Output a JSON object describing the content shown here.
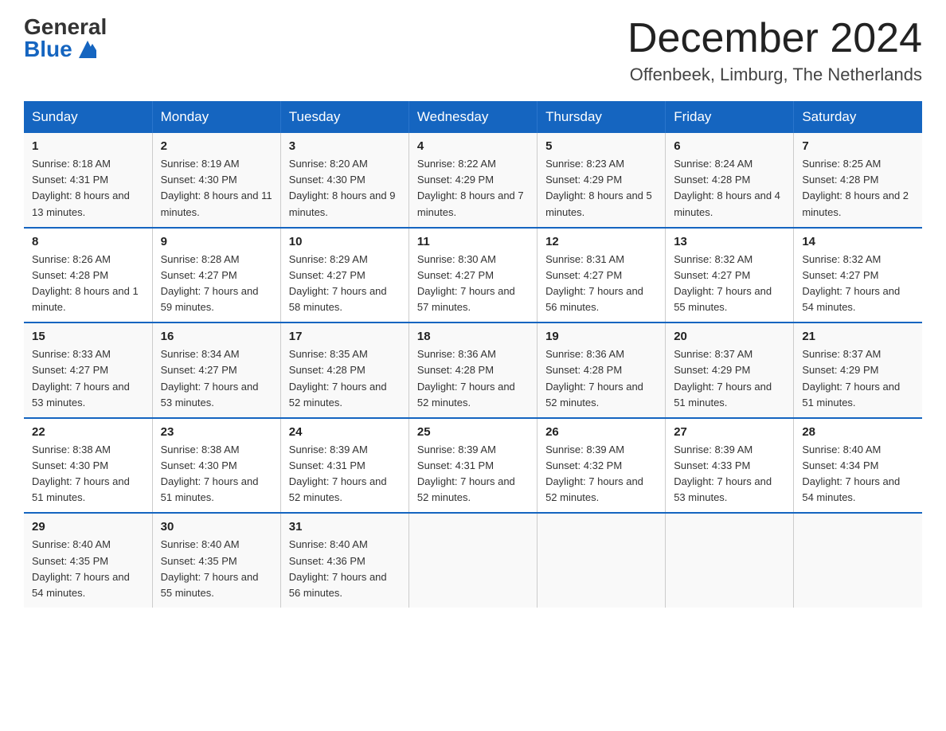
{
  "header": {
    "logo_general": "General",
    "logo_blue": "Blue",
    "month_title": "December 2024",
    "location": "Offenbeek, Limburg, The Netherlands"
  },
  "days_of_week": [
    "Sunday",
    "Monday",
    "Tuesday",
    "Wednesday",
    "Thursday",
    "Friday",
    "Saturday"
  ],
  "weeks": [
    [
      {
        "day": "1",
        "sunrise": "8:18 AM",
        "sunset": "4:31 PM",
        "daylight": "8 hours and 13 minutes."
      },
      {
        "day": "2",
        "sunrise": "8:19 AM",
        "sunset": "4:30 PM",
        "daylight": "8 hours and 11 minutes."
      },
      {
        "day": "3",
        "sunrise": "8:20 AM",
        "sunset": "4:30 PM",
        "daylight": "8 hours and 9 minutes."
      },
      {
        "day": "4",
        "sunrise": "8:22 AM",
        "sunset": "4:29 PM",
        "daylight": "8 hours and 7 minutes."
      },
      {
        "day": "5",
        "sunrise": "8:23 AM",
        "sunset": "4:29 PM",
        "daylight": "8 hours and 5 minutes."
      },
      {
        "day": "6",
        "sunrise": "8:24 AM",
        "sunset": "4:28 PM",
        "daylight": "8 hours and 4 minutes."
      },
      {
        "day": "7",
        "sunrise": "8:25 AM",
        "sunset": "4:28 PM",
        "daylight": "8 hours and 2 minutes."
      }
    ],
    [
      {
        "day": "8",
        "sunrise": "8:26 AM",
        "sunset": "4:28 PM",
        "daylight": "8 hours and 1 minute."
      },
      {
        "day": "9",
        "sunrise": "8:28 AM",
        "sunset": "4:27 PM",
        "daylight": "7 hours and 59 minutes."
      },
      {
        "day": "10",
        "sunrise": "8:29 AM",
        "sunset": "4:27 PM",
        "daylight": "7 hours and 58 minutes."
      },
      {
        "day": "11",
        "sunrise": "8:30 AM",
        "sunset": "4:27 PM",
        "daylight": "7 hours and 57 minutes."
      },
      {
        "day": "12",
        "sunrise": "8:31 AM",
        "sunset": "4:27 PM",
        "daylight": "7 hours and 56 minutes."
      },
      {
        "day": "13",
        "sunrise": "8:32 AM",
        "sunset": "4:27 PM",
        "daylight": "7 hours and 55 minutes."
      },
      {
        "day": "14",
        "sunrise": "8:32 AM",
        "sunset": "4:27 PM",
        "daylight": "7 hours and 54 minutes."
      }
    ],
    [
      {
        "day": "15",
        "sunrise": "8:33 AM",
        "sunset": "4:27 PM",
        "daylight": "7 hours and 53 minutes."
      },
      {
        "day": "16",
        "sunrise": "8:34 AM",
        "sunset": "4:27 PM",
        "daylight": "7 hours and 53 minutes."
      },
      {
        "day": "17",
        "sunrise": "8:35 AM",
        "sunset": "4:28 PM",
        "daylight": "7 hours and 52 minutes."
      },
      {
        "day": "18",
        "sunrise": "8:36 AM",
        "sunset": "4:28 PM",
        "daylight": "7 hours and 52 minutes."
      },
      {
        "day": "19",
        "sunrise": "8:36 AM",
        "sunset": "4:28 PM",
        "daylight": "7 hours and 52 minutes."
      },
      {
        "day": "20",
        "sunrise": "8:37 AM",
        "sunset": "4:29 PM",
        "daylight": "7 hours and 51 minutes."
      },
      {
        "day": "21",
        "sunrise": "8:37 AM",
        "sunset": "4:29 PM",
        "daylight": "7 hours and 51 minutes."
      }
    ],
    [
      {
        "day": "22",
        "sunrise": "8:38 AM",
        "sunset": "4:30 PM",
        "daylight": "7 hours and 51 minutes."
      },
      {
        "day": "23",
        "sunrise": "8:38 AM",
        "sunset": "4:30 PM",
        "daylight": "7 hours and 51 minutes."
      },
      {
        "day": "24",
        "sunrise": "8:39 AM",
        "sunset": "4:31 PM",
        "daylight": "7 hours and 52 minutes."
      },
      {
        "day": "25",
        "sunrise": "8:39 AM",
        "sunset": "4:31 PM",
        "daylight": "7 hours and 52 minutes."
      },
      {
        "day": "26",
        "sunrise": "8:39 AM",
        "sunset": "4:32 PM",
        "daylight": "7 hours and 52 minutes."
      },
      {
        "day": "27",
        "sunrise": "8:39 AM",
        "sunset": "4:33 PM",
        "daylight": "7 hours and 53 minutes."
      },
      {
        "day": "28",
        "sunrise": "8:40 AM",
        "sunset": "4:34 PM",
        "daylight": "7 hours and 54 minutes."
      }
    ],
    [
      {
        "day": "29",
        "sunrise": "8:40 AM",
        "sunset": "4:35 PM",
        "daylight": "7 hours and 54 minutes."
      },
      {
        "day": "30",
        "sunrise": "8:40 AM",
        "sunset": "4:35 PM",
        "daylight": "7 hours and 55 minutes."
      },
      {
        "day": "31",
        "sunrise": "8:40 AM",
        "sunset": "4:36 PM",
        "daylight": "7 hours and 56 minutes."
      },
      null,
      null,
      null,
      null
    ]
  ],
  "labels": {
    "sunrise": "Sunrise:",
    "sunset": "Sunset:",
    "daylight": "Daylight:"
  }
}
